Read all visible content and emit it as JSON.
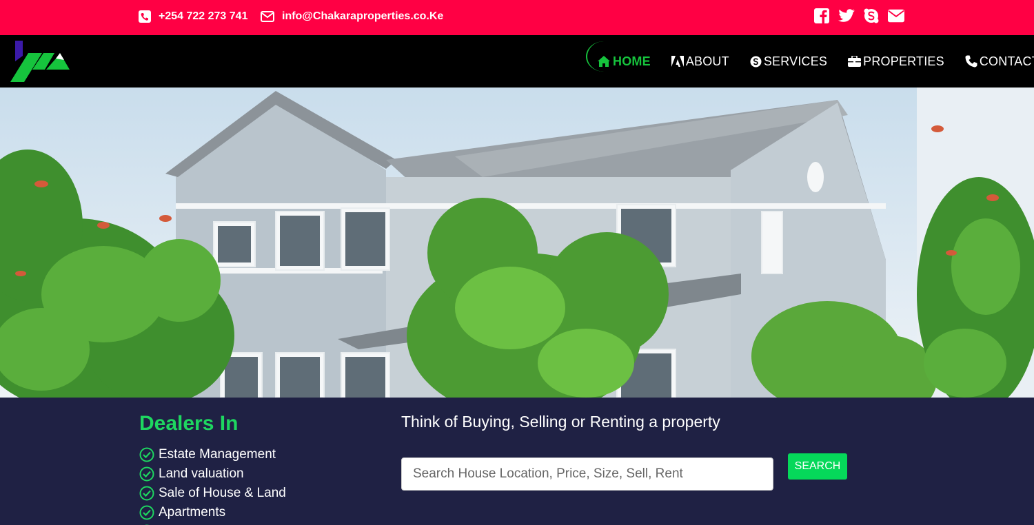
{
  "topbar": {
    "phone": "+254 722 273 741",
    "email": "info@Chakaraproperties.co.Ke",
    "phone_icon": "phone-square-icon",
    "email_icon": "envelope-outline-icon",
    "social_icons": [
      "facebook-icon",
      "twitter-icon",
      "skype-icon",
      "envelope-icon"
    ],
    "background": "#ff0044"
  },
  "nav": {
    "items": [
      {
        "label": "HOME",
        "icon": "home-icon"
      },
      {
        "label": "ABOUT",
        "icon": "adobe-icon"
      },
      {
        "label": "SERVICES",
        "icon": "skype-circle-icon"
      },
      {
        "label": "PROPERTIES",
        "icon": "briefcase-icon"
      },
      {
        "label": "CONTACT",
        "icon": "phone-icon"
      }
    ],
    "active_color": "#16c43d"
  },
  "dealers": {
    "title": "Dealers In",
    "items": [
      "Estate Management",
      "Land valuation",
      "Sale of House & Land",
      "Apartments"
    ]
  },
  "search": {
    "tagline": "Think of Buying, Selling or Renting a property",
    "placeholder": "Search House Location, Price, Size, Sell, Rent",
    "button_label": "SEARCH"
  },
  "colors": {
    "accent_green": "#1ed760",
    "section_bg": "#1f2144"
  }
}
